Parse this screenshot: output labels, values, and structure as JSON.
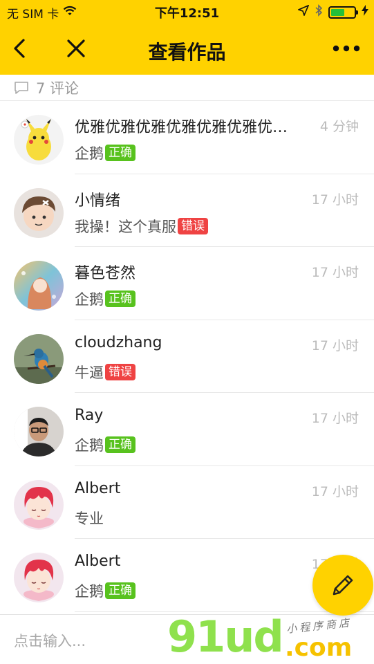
{
  "status_bar": {
    "carrier": "无 SIM 卡",
    "time": "下午12:51",
    "battery_level": 0.6
  },
  "nav": {
    "title": "查看作品",
    "back_icon": "chevron-left-icon",
    "close_icon": "close-icon",
    "more_icon": "more-icon"
  },
  "comments_header": {
    "label": "7 评论"
  },
  "comments": [
    {
      "name": "优雅优雅优雅优雅优雅优雅优雅优雅",
      "time": "4 分钟",
      "text": "企鹅",
      "badge": "正确",
      "badge_type": "ok",
      "avatar": "pikachu"
    },
    {
      "name": "小情绪",
      "time": "17 小时",
      "text": "我操！这个真服",
      "badge": "错误",
      "badge_type": "err",
      "avatar": "cartoon-boy"
    },
    {
      "name": "暮色苍然",
      "time": "17 小时",
      "text": "企鹅",
      "badge": "正确",
      "badge_type": "ok",
      "avatar": "anime-girl"
    },
    {
      "name": "cloudzhang",
      "time": "17 小时",
      "text": "牛逼",
      "badge": "错误",
      "badge_type": "err",
      "avatar": "kingfisher"
    },
    {
      "name": "Ray",
      "time": "17 小时",
      "text": "企鹅",
      "badge": "正确",
      "badge_type": "ok",
      "avatar": "man-glasses"
    },
    {
      "name": "Albert",
      "time": "17 小时",
      "text": "专业",
      "badge": "",
      "badge_type": "",
      "avatar": "anime-redhead"
    },
    {
      "name": "Albert",
      "time": "17 小时",
      "text": "企鹅",
      "badge": "正确",
      "badge_type": "ok",
      "avatar": "anime-redhead"
    }
  ],
  "bottom": {
    "placeholder": "点击输入..."
  },
  "fab": {
    "icon": "pencil-icon"
  },
  "watermark": {
    "main": "91ud",
    "tld": ".com",
    "tagline": "小程序商店"
  },
  "colors": {
    "brand_yellow": "#FFD200",
    "ok_green": "#58c21e",
    "err_red": "#ef4343"
  }
}
